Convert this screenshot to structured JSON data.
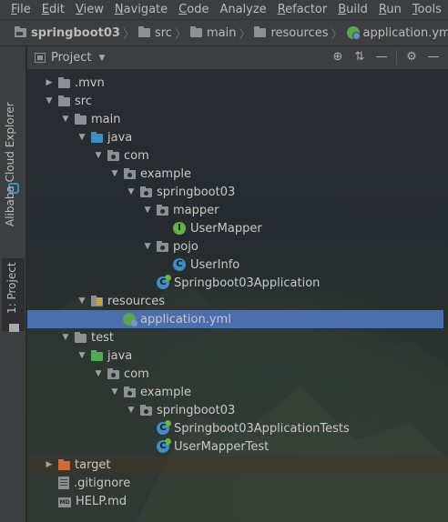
{
  "menu": [
    {
      "mnemonic": "F",
      "rest": "ile"
    },
    {
      "mnemonic": "E",
      "rest": "dit"
    },
    {
      "mnemonic": "V",
      "rest": "iew"
    },
    {
      "mnemonic": "N",
      "rest": "avigate"
    },
    {
      "mnemonic": "C",
      "rest": "ode"
    },
    {
      "mnemonic": "",
      "rest": "Analyze"
    },
    {
      "mnemonic": "R",
      "rest": "efactor"
    },
    {
      "mnemonic": "B",
      "rest": "uild"
    },
    {
      "mnemonic": "R",
      "rest": "un"
    },
    {
      "mnemonic": "T",
      "rest": "ools"
    }
  ],
  "breadcrumb": [
    "springboot03",
    "src",
    "main",
    "resources",
    "application.yml"
  ],
  "left_strip": {
    "alibaba_tab": "Alibaba Cloud Explorer",
    "project_tab": "1: Project"
  },
  "tool_window": {
    "title": "Project",
    "actions": [
      "locate-icon",
      "collapse-icon",
      "minimize-icon",
      "gear-icon",
      "hide-icon"
    ]
  },
  "tree": [
    {
      "label": ".mvn",
      "depth": 0,
      "arrow": "right",
      "icon": "folder"
    },
    {
      "label": "src",
      "depth": 0,
      "arrow": "down",
      "icon": "folder"
    },
    {
      "label": "main",
      "depth": 1,
      "arrow": "down",
      "icon": "folder"
    },
    {
      "label": "java",
      "depth": 2,
      "arrow": "down",
      "icon": "folder-blue"
    },
    {
      "label": "com",
      "depth": 3,
      "arrow": "down",
      "icon": "package"
    },
    {
      "label": "example",
      "depth": 4,
      "arrow": "down",
      "icon": "package"
    },
    {
      "label": "springboot03",
      "depth": 5,
      "arrow": "down",
      "icon": "package"
    },
    {
      "label": "mapper",
      "depth": 6,
      "arrow": "down",
      "icon": "package"
    },
    {
      "label": "UserMapper",
      "depth": 7,
      "arrow": "",
      "icon": "interface"
    },
    {
      "label": "pojo",
      "depth": 6,
      "arrow": "down",
      "icon": "package"
    },
    {
      "label": "UserInfo",
      "depth": 7,
      "arrow": "",
      "icon": "class"
    },
    {
      "label": "Springboot03Application",
      "depth": 6,
      "arrow": "",
      "icon": "spring"
    },
    {
      "label": "resources",
      "depth": 2,
      "arrow": "down",
      "icon": "resources"
    },
    {
      "label": "application.yml",
      "depth": 4,
      "arrow": "",
      "icon": "yml",
      "selected": true
    },
    {
      "label": "test",
      "depth": 1,
      "arrow": "down",
      "icon": "folder"
    },
    {
      "label": "java",
      "depth": 2,
      "arrow": "down",
      "icon": "folder-green"
    },
    {
      "label": "com",
      "depth": 3,
      "arrow": "down",
      "icon": "package"
    },
    {
      "label": "example",
      "depth": 4,
      "arrow": "down",
      "icon": "package"
    },
    {
      "label": "springboot03",
      "depth": 5,
      "arrow": "down",
      "icon": "package"
    },
    {
      "label": "Springboot03ApplicationTests",
      "depth": 6,
      "arrow": "",
      "icon": "spring"
    },
    {
      "label": "UserMapperTest",
      "depth": 6,
      "arrow": "",
      "icon": "spring"
    },
    {
      "label": "target",
      "depth": 0,
      "arrow": "right",
      "icon": "folder-orange"
    },
    {
      "label": ".gitignore",
      "depth": 0,
      "arrow": "",
      "icon": "file"
    },
    {
      "label": "HELP.md",
      "depth": 0,
      "arrow": "",
      "icon": "md"
    }
  ],
  "colors": {
    "selection": "#4b6eaf",
    "chrome": "#3c3f41",
    "package_folder": "#8c9094",
    "source_folder": "#3d8ec3",
    "test_folder": "#54a857",
    "excluded_folder": "#cf6a3a"
  }
}
